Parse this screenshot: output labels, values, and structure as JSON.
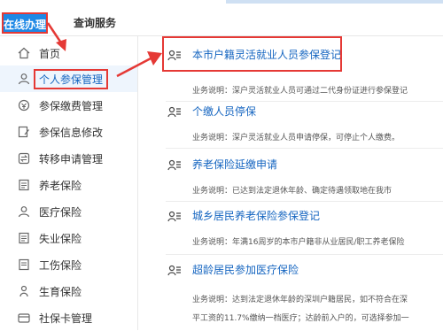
{
  "tabs": {
    "online": "在线办理",
    "query": "查询服务"
  },
  "sidebar": [
    {
      "label": "首页",
      "icon": "home-icon"
    },
    {
      "label": "个人参保管理",
      "icon": "person-icon"
    },
    {
      "label": "参保缴费管理",
      "icon": "payment-icon"
    },
    {
      "label": "参保信息修改",
      "icon": "edit-icon"
    },
    {
      "label": "转移申请管理",
      "icon": "transfer-icon"
    },
    {
      "label": "养老保险",
      "icon": "document-icon"
    },
    {
      "label": "医疗保险",
      "icon": "person-icon"
    },
    {
      "label": "失业保险",
      "icon": "document-icon"
    },
    {
      "label": "工伤保险",
      "icon": "document-icon"
    },
    {
      "label": "生育保险",
      "icon": "person-icon"
    },
    {
      "label": "社保卡管理",
      "icon": "card-icon"
    }
  ],
  "services": [
    {
      "title": "本市户籍灵活就业人员参保登记",
      "desc": "业务说明：深户灵活就业人员可通过二代身份证进行参保登记"
    },
    {
      "title": "个缴人员停保",
      "desc": "业务说明：深户灵活就业人员申请停保，可停止个人缴费。"
    },
    {
      "title": "养老保险延缴申请",
      "desc": "业务说明：已达到法定退休年龄、确定待遇领取地在我市"
    },
    {
      "title": "城乡居民养老保险参保登记",
      "desc": "业务说明：年满16周岁的本市户籍非从业居民/职工养老保险"
    },
    {
      "title": "超龄居民参加医疗保险",
      "desc": "业务说明：达到法定退休年龄的深圳户籍居民，如不符合在深",
      "desc2": "平工资的11.7%缴纳一档医疗；达龄前入户的，可选择参加一"
    }
  ],
  "colors": {
    "accent": "#1e88e5",
    "highlight": "#e53935",
    "link": "#1565c0"
  }
}
